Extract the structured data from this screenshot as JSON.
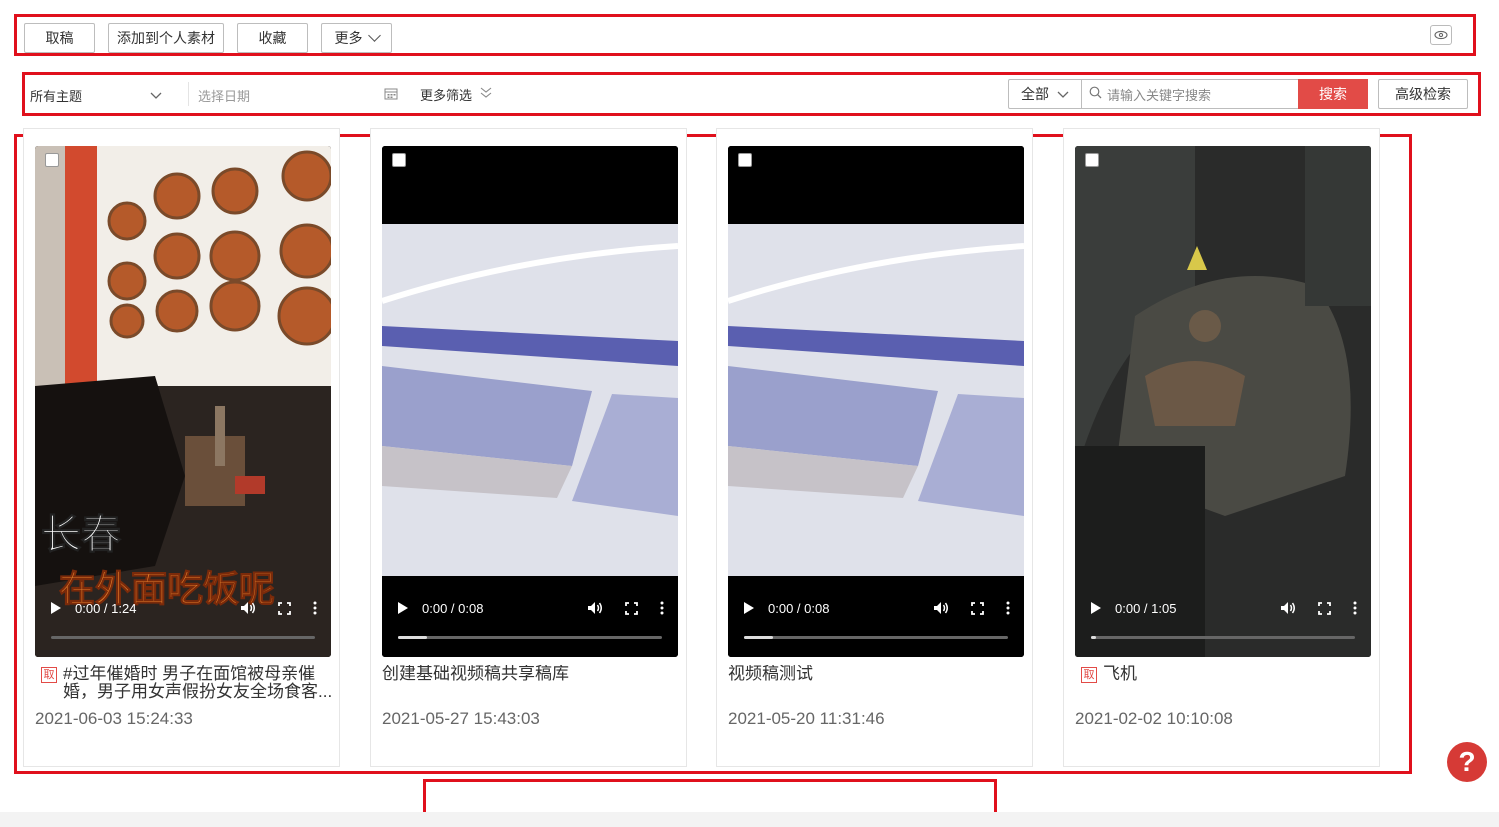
{
  "toolbar": {
    "buttons": [
      "取稿",
      "添加到个人素材",
      "收藏"
    ],
    "more_label": "更多"
  },
  "filter": {
    "topic_value": "所有主题",
    "date_placeholder": "选择日期",
    "more_filter_label": "更多筛选",
    "scope_value": "全部",
    "search_placeholder": "请输入关键字搜索",
    "search_button": "搜索",
    "advanced_button": "高级检索"
  },
  "cards": [
    {
      "title": "#过年催婚时 男子在面馆被母亲催婚，男子用女声假扮女友全场食客...",
      "tag": "取",
      "date": "2021-06-03 15:24:33",
      "time": "0:00 / 1:24",
      "thumbnail": "noodle-restaurant",
      "overlay_text": [
        "长春",
        "在外面吃饭呢"
      ],
      "progress": 0
    },
    {
      "title": "创建基础视频稿共享稿库",
      "tag": "",
      "date": "2021-05-27 15:43:03",
      "time": "0:00 / 0:08",
      "thumbnail": "keyboard-abstract",
      "progress": 0.11
    },
    {
      "title": "视频稿测试",
      "tag": "",
      "date": "2021-05-20 11:31:46",
      "time": "0:00 / 0:08",
      "thumbnail": "keyboard-abstract",
      "progress": 0.11
    },
    {
      "title": "飞机",
      "tag": "取",
      "date": "2021-02-02 10:10:08",
      "time": "0:00 / 1:05",
      "thumbnail": "fighter-jet-cockpit",
      "progress": 0.02
    }
  ],
  "help_label": "?",
  "colors": {
    "highlight_border": "#e0101c",
    "search_button": "#e24b47",
    "help_button": "#d63a36"
  }
}
